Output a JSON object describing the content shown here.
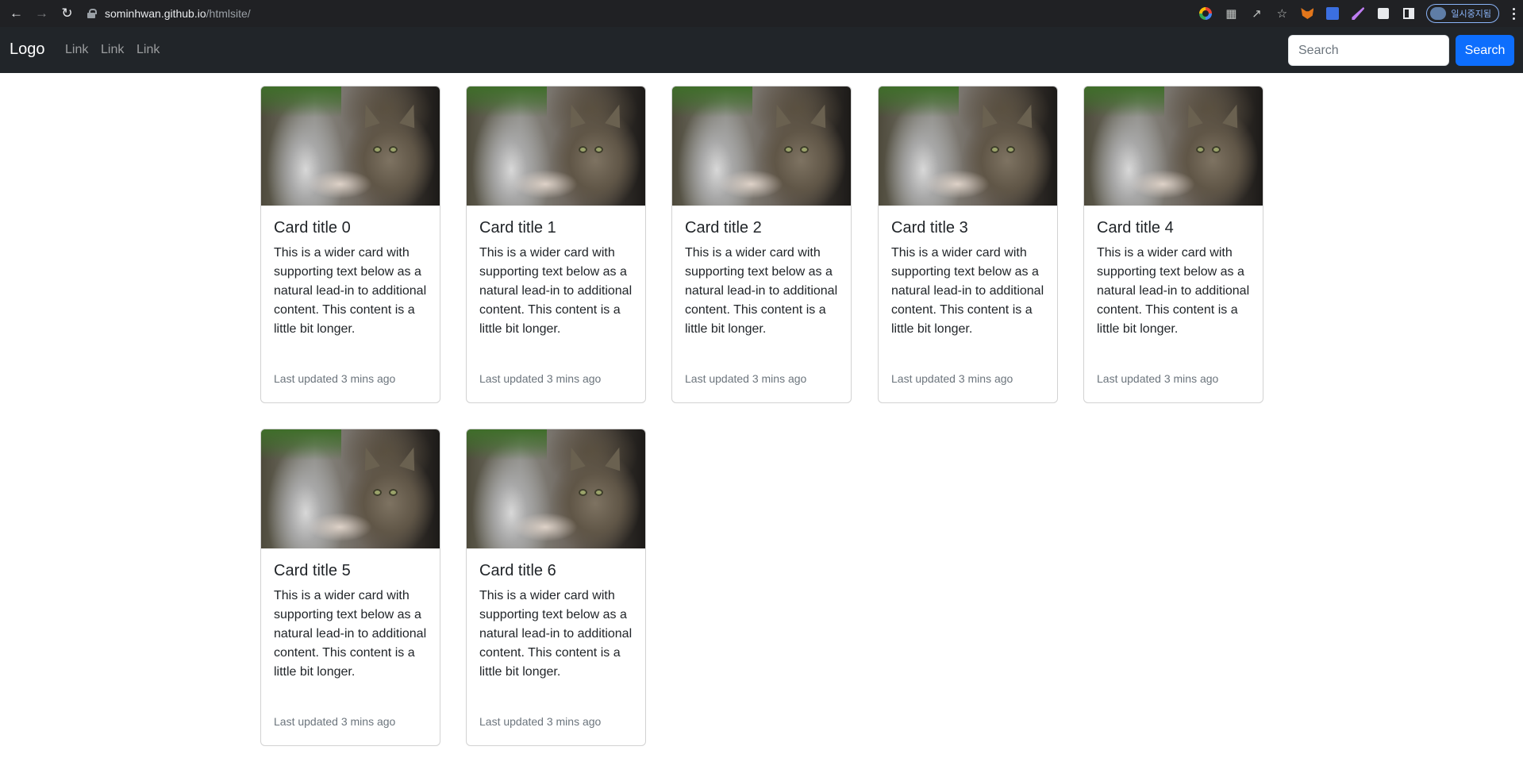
{
  "browser": {
    "url_host": "sominhwan.github.io",
    "url_path": "/htmlsite/",
    "profile_label": "일시중지됨",
    "icons": [
      "back-arrow-icon",
      "forward-arrow-icon",
      "reload-icon",
      "lock-icon",
      "google-icon",
      "translate-icon",
      "share-icon",
      "star-icon",
      "metamask-icon",
      "extension-icon",
      "feather-icon",
      "puzzle-icon",
      "side-panel-icon",
      "kebab-menu-icon"
    ]
  },
  "navbar": {
    "brand": "Logo",
    "links": [
      "Link",
      "Link",
      "Link"
    ],
    "search_placeholder": "Search",
    "search_button": "Search",
    "button_color": "#0d6efd",
    "background": "#212529"
  },
  "cards": [
    {
      "title": "Card title 0",
      "text": "This is a wider card with supporting text below as a natural lead-in to additional content. This content is a little bit longer.",
      "meta": "Last updated 3 mins ago"
    },
    {
      "title": "Card title 1",
      "text": "This is a wider card with supporting text below as a natural lead-in to additional content. This content is a little bit longer.",
      "meta": "Last updated 3 mins ago"
    },
    {
      "title": "Card title 2",
      "text": "This is a wider card with supporting text below as a natural lead-in to additional content. This content is a little bit longer.",
      "meta": "Last updated 3 mins ago"
    },
    {
      "title": "Card title 3",
      "text": "This is a wider card with supporting text below as a natural lead-in to additional content. This content is a little bit longer.",
      "meta": "Last updated 3 mins ago"
    },
    {
      "title": "Card title 4",
      "text": "This is a wider card with supporting text below as a natural lead-in to additional content. This content is a little bit longer.",
      "meta": "Last updated 3 mins ago"
    },
    {
      "title": "Card title 5",
      "text": "This is a wider card with supporting text below as a natural lead-in to additional content. This content is a little bit longer.",
      "meta": "Last updated 3 mins ago"
    },
    {
      "title": "Card title 6",
      "text": "This is a wider card with supporting text below as a natural lead-in to additional content. This content is a little bit longer.",
      "meta": "Last updated 3 mins ago"
    }
  ]
}
